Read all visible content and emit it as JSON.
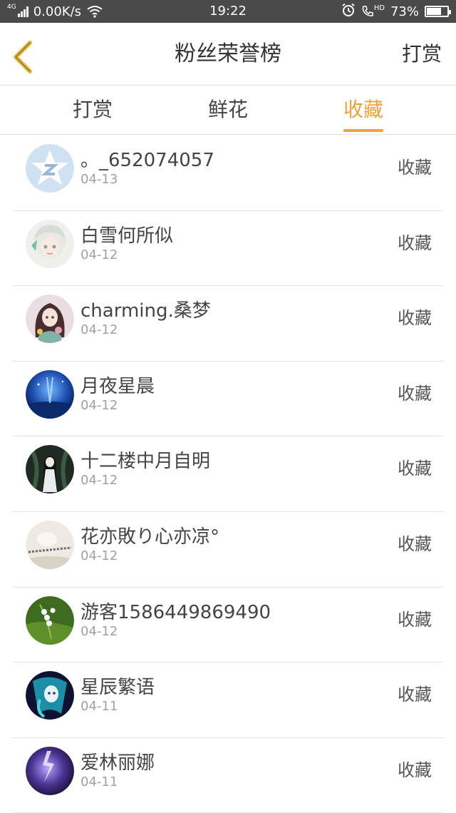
{
  "status_bar": {
    "network_tag": "4G",
    "speed": "0.00K/s",
    "time": "19:22",
    "hd_label": "HD",
    "battery_text": "73%",
    "battery_level": 0.73
  },
  "header": {
    "title": "粉丝荣誉榜",
    "action": "打赏"
  },
  "tabs": [
    {
      "label": "打赏",
      "active": false
    },
    {
      "label": "鲜花",
      "active": false
    },
    {
      "label": "收藏",
      "active": true
    }
  ],
  "colors": {
    "accent": "#f0a23a",
    "back_arrow": "#e8b83a",
    "status_bar_bg": "#4a4a4a"
  },
  "fans": [
    {
      "name": "。_652074057",
      "date": "04-13",
      "action": "收藏",
      "avatar": "star-logo-avatar"
    },
    {
      "name": "白雪何所似",
      "date": "04-12",
      "action": "收藏",
      "avatar": "anime-girl-avatar"
    },
    {
      "name": "charming.桑梦",
      "date": "04-12",
      "action": "收藏",
      "avatar": "anime-girl-avatar"
    },
    {
      "name": "月夜星晨",
      "date": "04-12",
      "action": "收藏",
      "avatar": "blue-night-avatar"
    },
    {
      "name": "十二楼中月自明",
      "date": "04-12",
      "action": "收藏",
      "avatar": "dark-figure-avatar"
    },
    {
      "name": "花亦敗り心亦凉°",
      "date": "04-12",
      "action": "收藏",
      "avatar": "light-photo-avatar"
    },
    {
      "name": "游客1586449869490",
      "date": "04-12",
      "action": "收藏",
      "avatar": "lily-flower-avatar"
    },
    {
      "name": "星辰繁语",
      "date": "04-11",
      "action": "收藏",
      "avatar": "blue-anime-avatar"
    },
    {
      "name": "爱林丽娜",
      "date": "04-11",
      "action": "收藏",
      "avatar": "purple-lightning-avatar"
    }
  ]
}
